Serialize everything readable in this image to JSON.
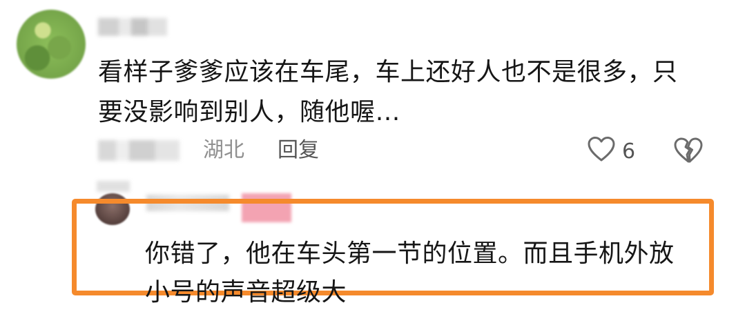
{
  "comment": {
    "text_line1": "看样子爹爹应该在车尾，车上还好人也不是很多，只",
    "text_line2": "要没影响到别人，随他喔…",
    "location": "湖北",
    "reply_label": "回复",
    "like_count": "6",
    "icons": {
      "like": "heart-outline-icon",
      "dislike": "broken-heart-icon"
    }
  },
  "reply": {
    "text_line1": "你错了，他在车头第一节的位置。而且手机外放",
    "text_line2": "小号的声音超级大",
    "highlight_color": "#f58a2c"
  }
}
